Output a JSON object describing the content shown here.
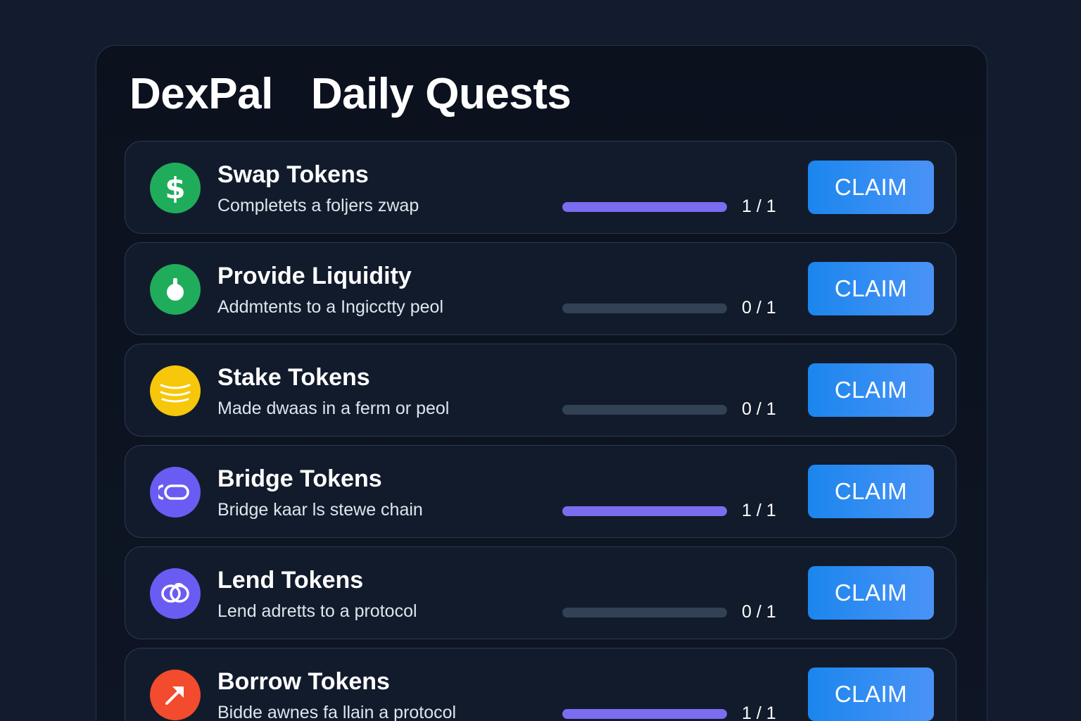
{
  "header": {
    "brand": "DexPal",
    "title": "Daily Quests"
  },
  "claim_label": "CLAIM",
  "quests": [
    {
      "title": "Swap Tokens",
      "description": "Completets a foljers zwap",
      "progress_text": "1 / 1",
      "progress": 1.0,
      "icon": "dollar-icon",
      "icon_color": "#1fad5c"
    },
    {
      "title": "Provide Liquidity",
      "description": "Addmtents to a Ingicctty peol",
      "progress_text": "0 / 1",
      "progress": 0.0,
      "icon": "liquidity-drop-icon",
      "icon_color": "#1fad5c"
    },
    {
      "title": "Stake Tokens",
      "description": "Made dwaas in a ferm or peol",
      "progress_text": "0 / 1",
      "progress": 0.0,
      "icon": "coin-stack-icon",
      "icon_color": "#f6c70a"
    },
    {
      "title": "Bridge Tokens",
      "description": "Bridge kaar ls stewe chain",
      "progress_text": "1 / 1",
      "progress": 1.0,
      "icon": "bridge-link-icon",
      "icon_color": "#6a5cf2"
    },
    {
      "title": "Lend Tokens",
      "description": "Lend adretts to a protocol",
      "progress_text": "0 / 1",
      "progress": 0.0,
      "icon": "lend-loop-icon",
      "icon_color": "#6a5cf2"
    },
    {
      "title": "Borrow Tokens",
      "description": "Bidde awnes fa llain a protocol",
      "progress_text": "1 / 1",
      "progress": 1.0,
      "icon": "arrow-up-right-icon",
      "icon_color": "#f24b2d"
    }
  ]
}
